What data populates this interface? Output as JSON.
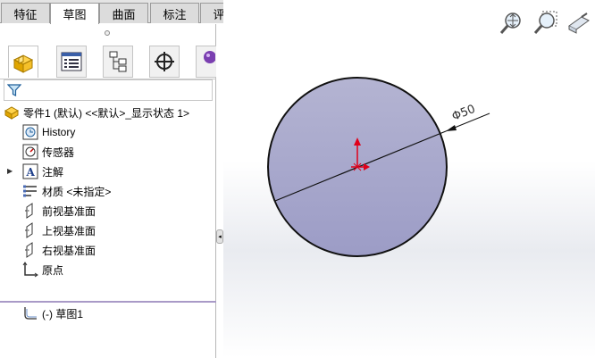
{
  "tabs": [
    {
      "label": "特征",
      "active": false
    },
    {
      "label": "草图",
      "active": true
    },
    {
      "label": "曲面",
      "active": false
    },
    {
      "label": "标注",
      "active": false
    },
    {
      "label": "评估",
      "active": false
    }
  ],
  "tree": {
    "root": "零件1 (默认) <<默认>_显示状态 1>",
    "items": [
      {
        "label": "History",
        "icon": "history-icon"
      },
      {
        "label": "传感器",
        "icon": "sensor-icon"
      },
      {
        "label": "注解",
        "icon": "annotation-icon"
      },
      {
        "label": "材质 <未指定>",
        "icon": "material-icon"
      },
      {
        "label": "前视基准面",
        "icon": "plane-icon"
      },
      {
        "label": "上视基准面",
        "icon": "plane-icon"
      },
      {
        "label": "右视基准面",
        "icon": "plane-icon"
      },
      {
        "label": "原点",
        "icon": "origin-icon"
      },
      {
        "label": "(-) 草图1",
        "icon": "sketch-icon"
      }
    ]
  },
  "drawing": {
    "dimension_label": "Φ50",
    "circle_fill": "#aeaed0",
    "origin_color": "#e0001a"
  }
}
